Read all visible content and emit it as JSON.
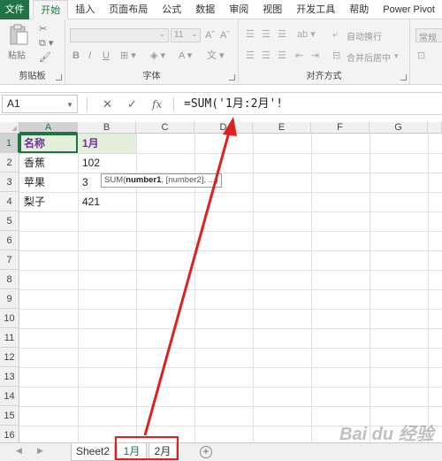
{
  "ribbon_tabs": [
    "文件",
    "开始",
    "插入",
    "页面布局",
    "公式",
    "数据",
    "审阅",
    "视图",
    "开发工具",
    "帮助",
    "Power Pivot"
  ],
  "ribbon": {
    "paste_label": "粘贴",
    "groups": {
      "clipboard": "剪贴板",
      "font": "字体",
      "alignment": "对齐方式"
    },
    "font_size": "11",
    "bold": "B",
    "italic": "I",
    "underline": "U",
    "grow_font": "Aˆ",
    "shrink_font": "Aˇ",
    "wrap_text": "自动换行",
    "merge_center": "合并后居中",
    "number_format": "常规"
  },
  "formula_bar": {
    "name_box": "A1",
    "formula": "=SUM('1月:2月'!",
    "fx_label": "fx"
  },
  "columns": [
    "A",
    "B",
    "C",
    "D",
    "E",
    "F",
    "G"
  ],
  "rows": [
    "1",
    "2",
    "3",
    "4",
    "5",
    "6",
    "7",
    "8",
    "9",
    "10",
    "11",
    "12",
    "13",
    "14",
    "15",
    "16"
  ],
  "cells": {
    "a1": "名称",
    "b1": "1月",
    "a2": "香蕉",
    "b2": "102",
    "a3": "苹果",
    "b3": "3",
    "a4": "梨子",
    "b4": "421"
  },
  "tooltip": {
    "prefix": "SUM(",
    "bold_arg": "number1",
    "rest": ", [number2], ...)"
  },
  "sheet_tabs": [
    "Sheet2",
    "1月",
    "2月"
  ],
  "colors": {
    "accent": "#217346",
    "header_fill": "#e2efda",
    "header_text": "#7030a0",
    "annotation": "#e01f1f"
  },
  "watermark": "Bai du 经验"
}
